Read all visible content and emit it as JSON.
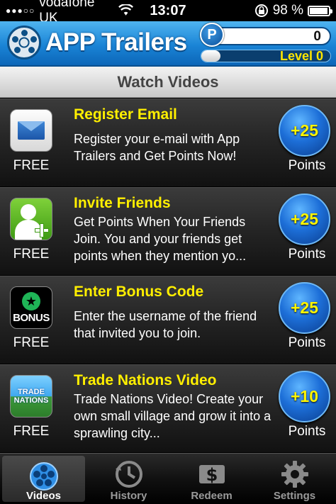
{
  "status_bar": {
    "carrier": "vodafone UK",
    "time": "13:07",
    "battery": "98 %",
    "battery_level": 0.98
  },
  "header": {
    "app_title": "APP Trailers",
    "points_badge": "P",
    "points": "0",
    "level_label": "Level 0",
    "level_progress": 0.15
  },
  "sub_header": {
    "title": "Watch Videos"
  },
  "offers": [
    {
      "title": "Register Email",
      "description": "Register your e-mail with App Trailers and Get Points Now!",
      "price": "FREE",
      "reward": "+25",
      "reward_label": "Points",
      "icon": "email-icon"
    },
    {
      "title": "Invite Friends",
      "description": "Get Points When Your Friends Join. You  and your friends get points when they mention yo...",
      "price": "FREE",
      "reward": "+25",
      "reward_label": "Points",
      "icon": "invite-friends-icon"
    },
    {
      "title": "Enter Bonus Code",
      "description": "Enter the username of the friend that invited you to join.",
      "price": "FREE",
      "reward": "+25",
      "reward_label": "Points",
      "icon": "bonus-icon",
      "icon_text": "BONUS"
    },
    {
      "title": "Trade Nations Video",
      "description": "Trade Nations Video! Create your own small village and grow it into a sprawling city...",
      "price": "FREE",
      "reward": "+10",
      "reward_label": "Points",
      "icon": "trade-nations-icon",
      "icon_text": "TRADE NATIONS"
    }
  ],
  "tabs": [
    {
      "label": "Videos",
      "icon": "film-reel-icon",
      "active": true
    },
    {
      "label": "History",
      "icon": "clock-icon",
      "active": false
    },
    {
      "label": "Redeem",
      "icon": "dollar-icon",
      "active": false
    },
    {
      "label": "Settings",
      "icon": "gear-icon",
      "active": false
    }
  ],
  "colors": {
    "header_blue": "#1a84d6",
    "title_yellow": "#ffef00",
    "badge_blue": "#1d6fd8"
  }
}
